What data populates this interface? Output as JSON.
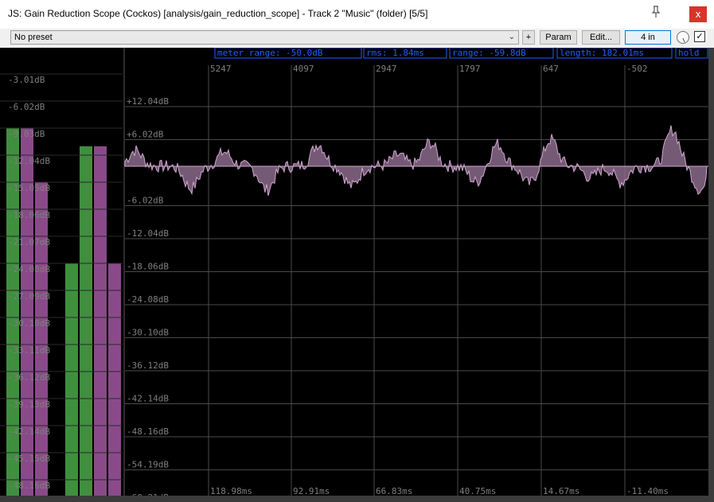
{
  "window": {
    "title": "JS: Gain Reduction Scope (Cockos) [analysis/gain_reduction_scope] - Track 2 \"Music\" (folder) [5/5]",
    "close_label": "x",
    "pin_icon": "pin-icon"
  },
  "toolbar": {
    "preset": "No preset",
    "plus_label": "+",
    "param_label": "Param",
    "edit_label": "Edit...",
    "io_label": "4 in",
    "checkbox_checked": true
  },
  "scope": {
    "info": {
      "meter_range": "meter range: -50.0dB",
      "rms": "rms: 1.84ms",
      "range": "range: -59.8dB",
      "length": "length: 182.01ms",
      "hold": "hold"
    },
    "meter_scale": [
      "-3.01dB",
      "-6.02dB",
      "-9.03dB",
      "-12.04dB",
      "-15.05dB",
      "-18.06dB",
      "-21.07dB",
      "-24.08dB",
      "-27.09dB",
      "-30.10dB",
      "-33.11dB",
      "-36.12dB",
      "-39.13dB",
      "-42.14dB",
      "-45.15dB",
      "-48.16dB"
    ],
    "meters": [
      {
        "color": "green",
        "level_db": -9.0
      },
      {
        "color": "purple",
        "level_db": -9.0
      },
      {
        "color": "purple",
        "level_db": -15.0
      },
      {
        "color": "green",
        "level_db": -24.1
      },
      {
        "color": "green",
        "level_db": -11.0
      },
      {
        "color": "purple",
        "level_db": -11.0
      },
      {
        "color": "purple",
        "level_db": -24.1
      }
    ],
    "plot_y_labels": [
      "+12.04dB",
      "+6.02dB",
      "-6.02dB",
      "-12.04dB",
      "-18.06dB",
      "-24.08dB",
      "-30.10dB",
      "-36.12dB",
      "-42.14dB",
      "-48.16dB",
      "-54.19dB",
      "-60.21dB"
    ],
    "top_ticks": [
      "5247",
      "4097",
      "2947",
      "1797",
      "647",
      "-502"
    ],
    "bottom_ticks": [
      "118.98ms",
      "92.91ms",
      "66.83ms",
      "40.75ms",
      "14.67ms",
      "-11.40ms"
    ],
    "colors": {
      "green": "#3f8f3f",
      "purple": "#8a4a8a",
      "label": "#7f7f7f",
      "info_bg": "#000000",
      "info_text": "#1e5fff",
      "grid": "#4a4a4a",
      "trace": "#c9a0c9"
    }
  }
}
